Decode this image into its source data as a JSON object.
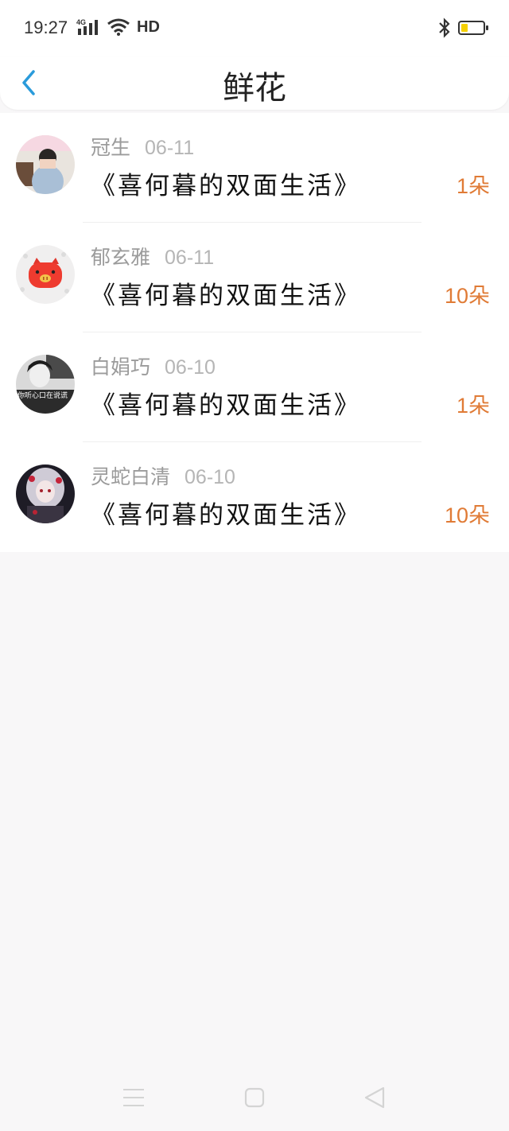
{
  "status": {
    "time": "19:27",
    "network": "4G",
    "hd": "HD",
    "battery_color": "#f5d000"
  },
  "header": {
    "title": "鲜花",
    "back_icon": "chevron-left-icon",
    "accent": "#2a9bdb"
  },
  "items": [
    {
      "name": "冠生",
      "date": "06-11",
      "book": "《喜何暮的双面生活》",
      "count": "1朵",
      "avatar": "girl-photo"
    },
    {
      "name": "郁玄雅",
      "date": "06-11",
      "book": "《喜何暮的双面生活》",
      "count": "10朵",
      "avatar": "pig-sticker"
    },
    {
      "name": "白娟巧",
      "date": "06-10",
      "book": "《喜何暮的双面生活》",
      "count": "1朵",
      "avatar": "bw-photo",
      "avatar_text": "你听心口在说谎"
    },
    {
      "name": "灵蛇白清",
      "date": "06-10",
      "book": "《喜何暮的双面生活》",
      "count": "10朵",
      "avatar": "anime-girl"
    }
  ],
  "navbar": {
    "menu_icon": "menu-icon",
    "home_icon": "home-square-icon",
    "back_icon": "back-triangle-icon"
  }
}
